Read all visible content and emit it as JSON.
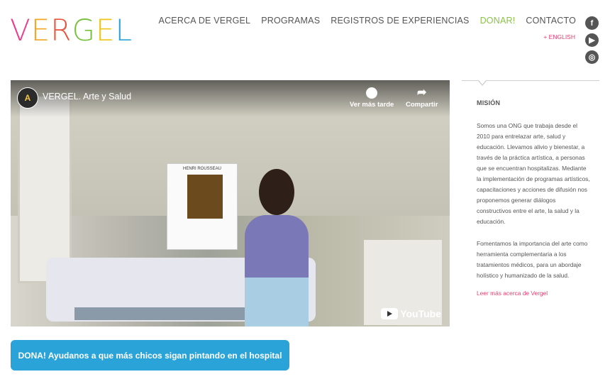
{
  "header": {
    "logo": {
      "letters": [
        "V",
        "E",
        "R",
        "G",
        "E",
        "L"
      ],
      "colors": [
        "#e83e8c",
        "#f5a623",
        "#e8553e",
        "#7ac142",
        "#f0c419",
        "#2aa3d9"
      ]
    },
    "nav": [
      {
        "label": "ACERCA DE VERGEL"
      },
      {
        "label": "PROGRAMAS"
      },
      {
        "label": "REGISTROS DE EXPERIENCIAS"
      },
      {
        "label": "DONAR!"
      },
      {
        "label": "CONTACTO"
      }
    ],
    "language_link": "+ ENGLISH",
    "social": [
      {
        "icon": "facebook-icon",
        "glyph": "f"
      },
      {
        "icon": "youtube-icon",
        "glyph": "▶"
      },
      {
        "icon": "instagram-icon",
        "glyph": "◎"
      }
    ]
  },
  "video": {
    "title": "VERGEL. Arte y Salud",
    "channel_badge": "A",
    "watch_later": "Ver más tarde",
    "share": "Compartir",
    "youtube_label": "YouTube",
    "book_title": "HENRI ROUSSEAU"
  },
  "donate_button": "DONA! Ayudanos a que más chicos sigan pintando en el hospital",
  "sidebar": {
    "heading": "MISIÓN",
    "paragraph1": "Somos una ONG que trabaja desde el 2010 para entrelazar arte, salud y educación. Llevamos alivio y bienestar, a través de la práctica artística, a personas que se encuentran hospitalizas. Mediante la implementación de programas artísticos, capacitaciones y acciones de difusión nos proponemos generar diálogos constructivos entre el arte, la salud y la educación.",
    "paragraph2": "Fomentamos la importancia del arte como herramienta complementaria a los tratamientos médicos, para un abordaje holístico y humanizado de la salud.",
    "more_link": "Leer más acerca de Vergel"
  }
}
